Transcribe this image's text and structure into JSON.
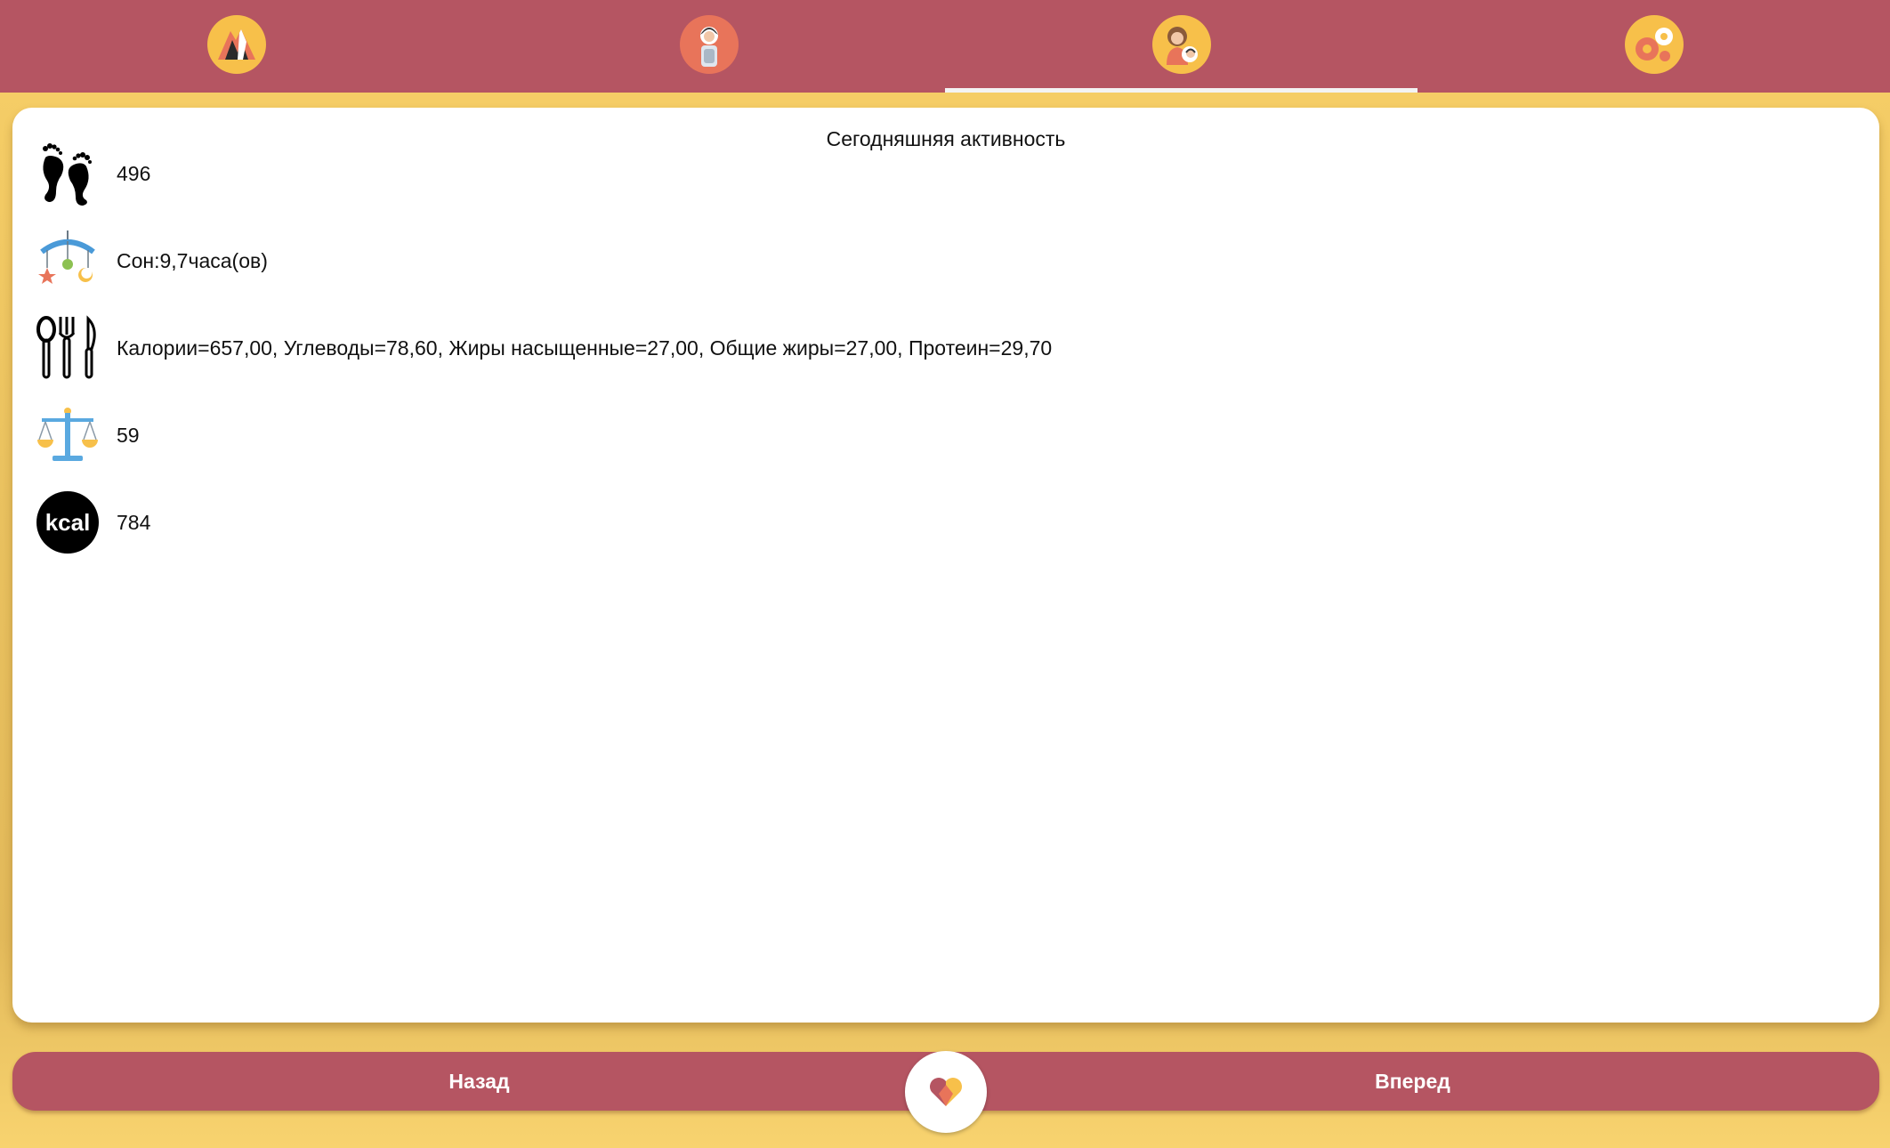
{
  "tabs": [
    {
      "icon": "mountain-icon",
      "active": false
    },
    {
      "icon": "pregnant-woman-icon",
      "active": false
    },
    {
      "icon": "mother-baby-icon",
      "active": true
    },
    {
      "icon": "gears-icon",
      "active": false
    }
  ],
  "card": {
    "title": "Сегодняшняя активность",
    "rows": [
      {
        "icon": "footprints-icon",
        "text": "496"
      },
      {
        "icon": "baby-mobile-icon",
        "text": "Сон:9,7часа(ов)"
      },
      {
        "icon": "cutlery-icon",
        "text": "Калории=657,00, Углеводы=78,60, Жиры насыщенные=27,00, Общие жиры=27,00, Протеин=29,70"
      },
      {
        "icon": "scales-icon",
        "text": "59"
      },
      {
        "icon": "kcal-icon",
        "icon_label": "kcal",
        "text": "784"
      }
    ]
  },
  "nav": {
    "back_label": "Назад",
    "forward_label": "Вперед",
    "center_icon": "heart-icon"
  },
  "colors": {
    "primary": "#b55562",
    "background": "#f8d36f",
    "card": "#ffffff"
  }
}
